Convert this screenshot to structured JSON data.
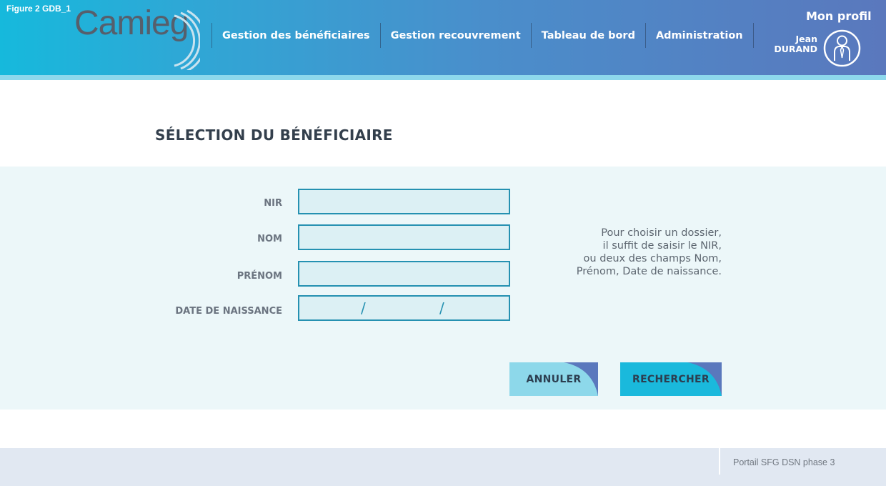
{
  "figure_label": "Figure 2 GDB_1",
  "logo": {
    "text": "Camieg"
  },
  "nav": {
    "items": [
      {
        "label": "Gestion des bénéficiaires"
      },
      {
        "label": "Gestion recouvrement"
      },
      {
        "label": "Tableau de bord"
      },
      {
        "label": "Administration"
      }
    ]
  },
  "profile": {
    "title": "Mon profil",
    "first_name": "Jean",
    "last_name": "DURAND"
  },
  "page": {
    "title": "SÉLECTION DU BÉNÉFICIAIRE"
  },
  "form": {
    "nir_label": "NIR",
    "nir_value": "",
    "nom_label": "NOM",
    "nom_value": "",
    "prenom_label": "PRÉNOM",
    "prenom_value": "",
    "dob_label": "DATE DE NAISSANCE",
    "dob_separator": "/",
    "help_lines": [
      "Pour choisir un dossier,",
      "il suffit de saisir le NIR,",
      "ou deux des champs Nom,",
      "Prénom, Date de naissance."
    ]
  },
  "actions": {
    "cancel_label": "ANNULER",
    "search_label": "RECHERCHER"
  },
  "footer": {
    "text": "Portail SFG DSN phase 3"
  },
  "colors": {
    "header_start": "#16b9dc",
    "header_end": "#5a78bd",
    "accent": "#1ab9dc",
    "input_border": "#2591b1"
  }
}
